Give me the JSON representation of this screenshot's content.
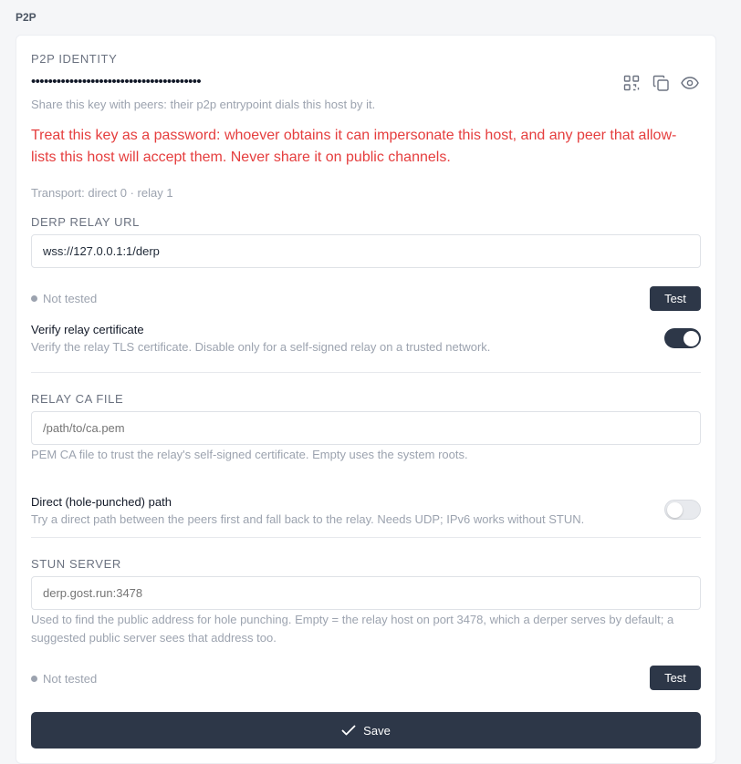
{
  "section": {
    "title": "P2P"
  },
  "identity": {
    "label": "P2P IDENTITY",
    "masked_key": "••••••••••••••••••••••••••••••••••••••••",
    "share_hint": "Share this key with peers: their p2p entrypoint dials this host by it.",
    "warning_line1": "Treat this key as a password: whoever obtains it can impersonate this host, and any peer that allow-",
    "warning_line2": "lists this host will accept them. Never share it on public channels.",
    "transport": "Transport: direct 0 · relay 1",
    "icons": [
      "qr-code-icon",
      "copy-icon",
      "eye-icon"
    ]
  },
  "derp": {
    "label": "DERP RELAY URL",
    "value": "wss://127.0.0.1:1/derp",
    "status": "Not tested",
    "test_label": "Test"
  },
  "verify_cert": {
    "title": "Verify relay certificate",
    "description": "Verify the relay TLS certificate. Disable only for a self-signed relay on a trusted network.",
    "enabled": true
  },
  "relay_ca": {
    "label": "RELAY CA FILE",
    "placeholder": "/path/to/ca.pem",
    "help": "PEM CA file to trust the relay's self-signed certificate. Empty uses the system roots."
  },
  "direct_path": {
    "title": "Direct (hole-punched) path",
    "description": "Try a direct path between the peers first and fall back to the relay. Needs UDP; IPv6 works without STUN.",
    "enabled": false
  },
  "stun": {
    "label": "STUN SERVER",
    "placeholder": "derp.gost.run:3478",
    "help_line1": "Used to find the public address for hole punching. Empty = the relay host on port 3478, which a derper serves by default; a",
    "help_line2": "suggested public server sees that address too.",
    "status": "Not tested",
    "test_label": "Test"
  },
  "save": {
    "label": "Save"
  },
  "colors": {
    "accent": "#2d3748",
    "danger": "#e53e3e",
    "muted": "#9ca3af"
  }
}
